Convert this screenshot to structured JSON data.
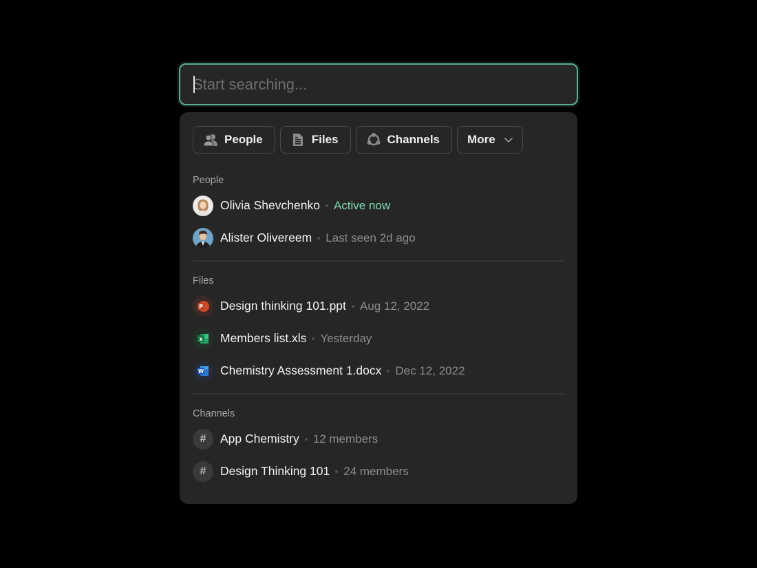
{
  "search": {
    "placeholder": "Start searching...",
    "value": ""
  },
  "filters": [
    {
      "label": "People",
      "icon": "people-icon"
    },
    {
      "label": "Files",
      "icon": "file-icon"
    },
    {
      "label": "Channels",
      "icon": "channels-icon"
    },
    {
      "label": "More",
      "icon": "chevron-down-icon"
    }
  ],
  "sections": {
    "people": {
      "label": "People",
      "items": [
        {
          "name": "Olivia Shevchenko",
          "status": "Active now",
          "status_type": "active"
        },
        {
          "name": "Alister Olivereem",
          "status": "Last seen 2d ago",
          "status_type": "inactive"
        }
      ]
    },
    "files": {
      "label": "Files",
      "items": [
        {
          "name": "Design thinking 101.ppt",
          "meta": "Aug 12, 2022",
          "type": "powerpoint"
        },
        {
          "name": "Members list.xls",
          "meta": "Yesterday",
          "type": "excel"
        },
        {
          "name": "Chemistry Assessment 1.docx",
          "meta": "Dec 12, 2022",
          "type": "word"
        }
      ]
    },
    "channels": {
      "label": "Channels",
      "items": [
        {
          "name": "App Chemistry",
          "meta": "12 members",
          "icon_glyph": "#"
        },
        {
          "name": "Design Thinking 101",
          "meta": "24 members",
          "icon_glyph": "#"
        }
      ]
    }
  },
  "colors": {
    "accent": "#5fae8c",
    "active_status": "#7fdcb2",
    "panel_bg": "#262626",
    "page_bg": "#000000"
  }
}
